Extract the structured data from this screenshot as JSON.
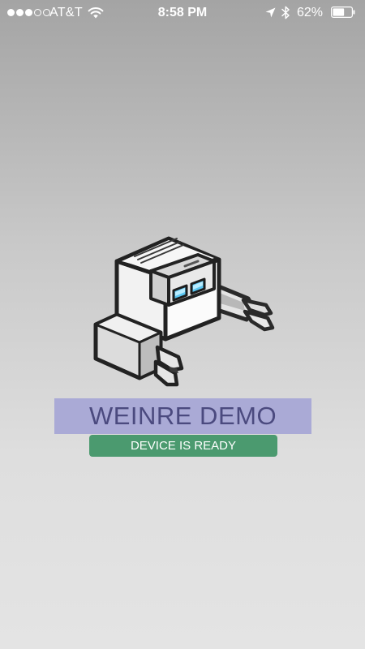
{
  "status_bar": {
    "signal_bars_filled": 3,
    "signal_bars_total": 5,
    "carrier": "AT&T",
    "time": "8:58 PM",
    "battery_percent": "62%",
    "battery_level": 0.62,
    "icons": [
      "wifi-icon",
      "location-arrow-icon",
      "bluetooth-icon",
      "battery-icon"
    ]
  },
  "app": {
    "logo": "weinre-robot-logo",
    "title": "WEINRE DEMO",
    "device_status": "DEVICE IS READY"
  },
  "colors": {
    "title_bg": "#aaaad6",
    "title_text": "#4b4a7f",
    "status_bg": "#4b9a6f",
    "status_text": "#ffffff"
  }
}
